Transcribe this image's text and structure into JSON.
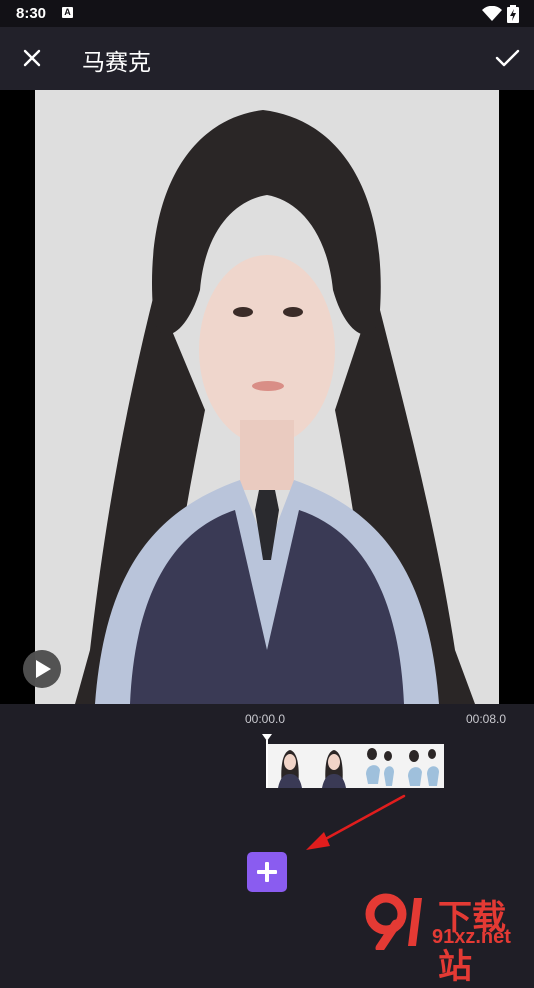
{
  "status_bar": {
    "time": "8:30",
    "notification_icon": "a-icon",
    "wifi_icon": "wifi-icon",
    "battery_icon": "battery-icon"
  },
  "toolbar": {
    "title": "马赛克",
    "close_icon": "close-icon",
    "confirm_icon": "check-icon"
  },
  "preview": {
    "play_icon": "play-icon"
  },
  "timeline": {
    "start_time": "00:00.0",
    "end_time": "00:08.0"
  },
  "add_button": {
    "icon": "plus-icon",
    "color": "#8a5cf0"
  },
  "watermark": {
    "brand_text": "下载站",
    "domain_text": "91xz.net"
  },
  "colors": {
    "background": "#1f1e26",
    "toolbar": "#22212a",
    "accent": "#8a5cf0",
    "annotation_arrow": "#e11d1d"
  }
}
